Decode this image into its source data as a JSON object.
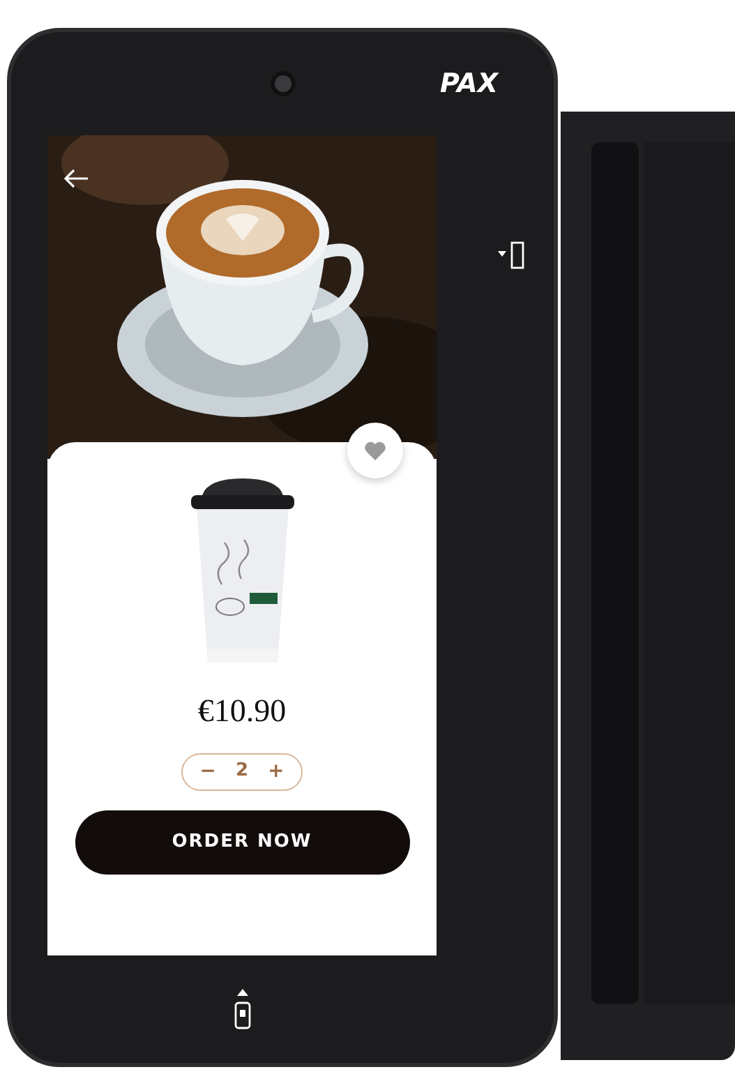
{
  "device": {
    "brand": "PAX"
  },
  "screen": {
    "favorite": {
      "selected": false
    },
    "product": {
      "price": "€10.90",
      "minus": "−",
      "quantity": "2",
      "plus": "+"
    },
    "order_button": "ORDER NOW"
  }
}
